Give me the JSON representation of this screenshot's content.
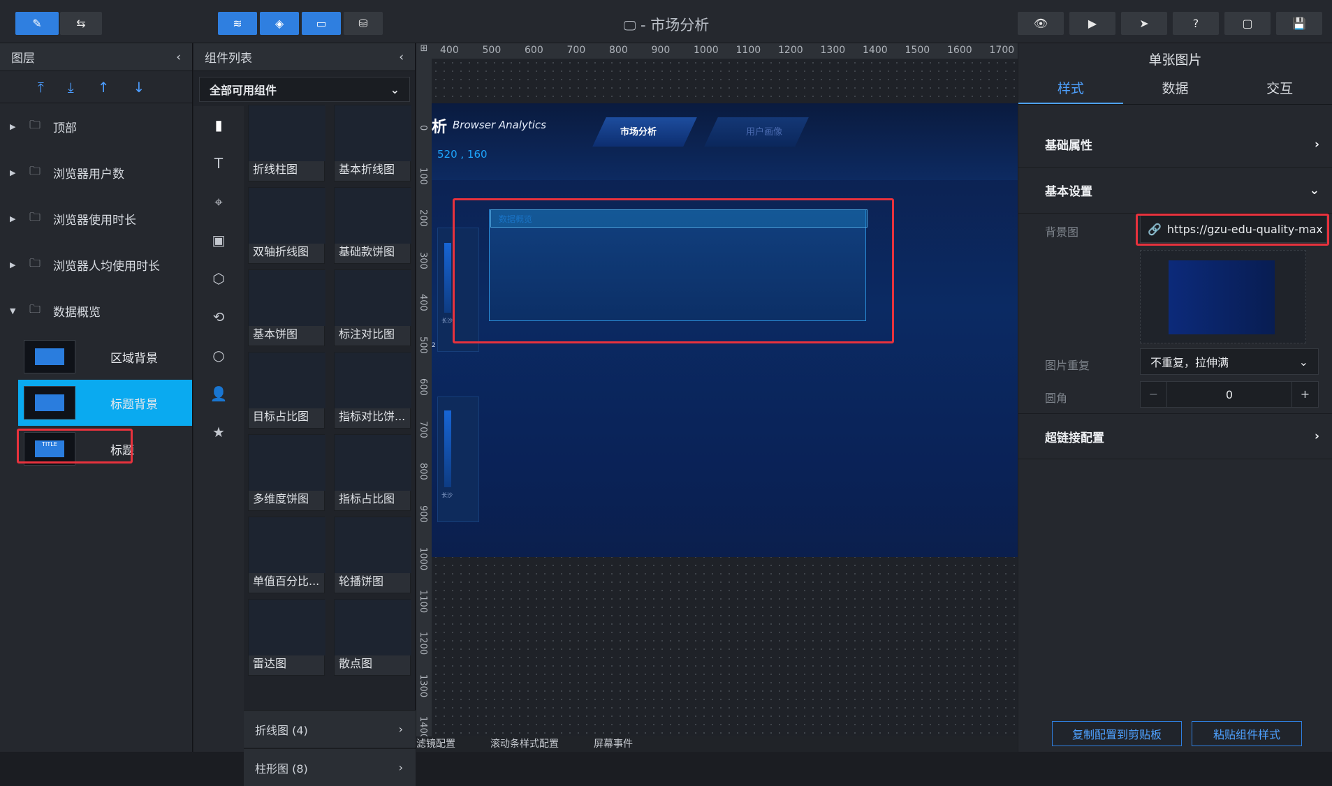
{
  "header": {
    "title": "- 市场分析",
    "colors": {
      "accent": "#2f7fe0",
      "bg": "#25282e"
    }
  },
  "layers": {
    "title": "图层",
    "folders": [
      {
        "label": "顶部",
        "expanded": false
      },
      {
        "label": "浏览器用户数",
        "expanded": false
      },
      {
        "label": "浏览器使用时长",
        "expanded": false
      },
      {
        "label": "浏览器人均使用时长",
        "expanded": false
      },
      {
        "label": "数据概览",
        "expanded": true
      }
    ],
    "items": [
      {
        "label": "区域背景"
      },
      {
        "label": "标题背景",
        "selected": true
      },
      {
        "label": "标题",
        "thumb_text": "TITLE"
      }
    ]
  },
  "components": {
    "title": "组件列表",
    "filter": "全部可用组件",
    "cards": [
      "折线柱图",
      "基本折线图",
      "双轴折线图",
      "基础款饼图",
      "基本饼图",
      "标注对比图",
      "目标占比图",
      "指标对比饼...",
      "多维度饼图",
      "指标占比图",
      "单值百分比...",
      "轮播饼图",
      "雷达图",
      "散点图"
    ],
    "sections": [
      "折线图 (4)",
      "柱形图 (8)"
    ]
  },
  "canvas": {
    "ruler_top": [
      "400",
      "500",
      "600",
      "700",
      "800",
      "900",
      "1000",
      "1100",
      "1200",
      "1300",
      "1400",
      "1500",
      "1600",
      "1700"
    ],
    "ruler_left": [
      "0",
      "100",
      "200",
      "300",
      "400",
      "500",
      "600",
      "700",
      "800",
      "900",
      "1000",
      "1100",
      "1200",
      "1300",
      "1400"
    ],
    "artboard": {
      "heading_char": "析",
      "subtitle": "Browser Analytics",
      "nav_active": "市场分析",
      "nav_other": "用户画像",
      "coords": "520 , 160",
      "box_label": "数据概览",
      "side_tag1": "长沙",
      "side_tag2": "长沙",
      "left_char": "2"
    },
    "bottom_tabs": [
      "滤镜配置",
      "滚动条样式配置",
      "屏幕事件"
    ]
  },
  "inspector": {
    "title": "单张图片",
    "tabs": [
      "样式",
      "数据",
      "交互"
    ],
    "sections": {
      "basic": "基础属性",
      "settings": "基本设置",
      "link": "超链接配置"
    },
    "bg_label": "背景图",
    "bg_url": "https://gzu-edu-quality-max",
    "repeat_label": "图片重复",
    "repeat_value": "不重复，拉伸满",
    "radius_label": "圆角",
    "radius_value": "0",
    "buttons": [
      "复制配置到剪贴板",
      "粘贴组件样式"
    ]
  }
}
